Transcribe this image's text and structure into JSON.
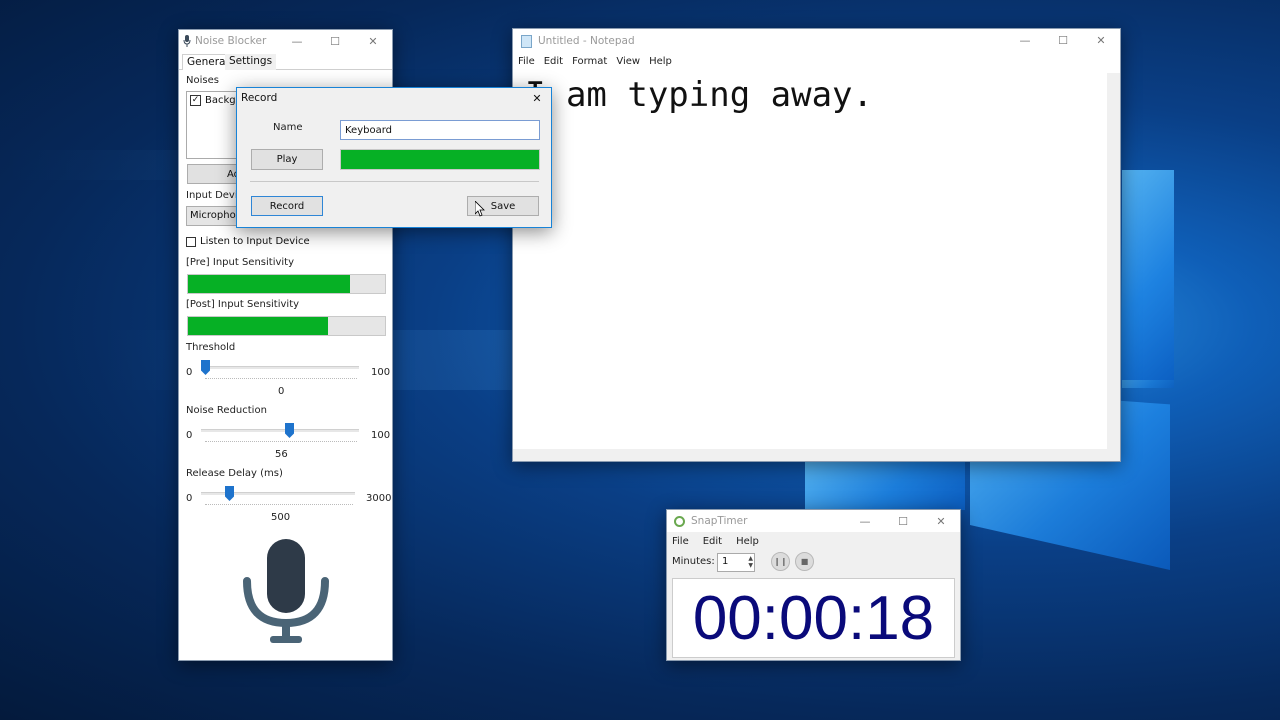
{
  "noise_blocker": {
    "title": "Noise Blocker",
    "tabs": [
      "General",
      "Settings"
    ],
    "noises_label": "Noises",
    "noise_item": "Backgro",
    "add_button": "Ad",
    "input_device_label": "Input Devic",
    "input_device_value": "Micropho",
    "listen_label": "Listen to Input Device",
    "pre_sensitivity_label": "[Pre] Input Sensitivity",
    "pre_sensitivity_level": 0.82,
    "post_sensitivity_label": "[Post] Input Sensitivity",
    "post_sensitivity_level": 0.71,
    "threshold": {
      "label": "Threshold",
      "min": "0",
      "max": "100",
      "value": "0"
    },
    "noise_reduction": {
      "label": "Noise Reduction",
      "min": "0",
      "max": "100",
      "value": "56"
    },
    "release_delay": {
      "label": "Release Delay (ms)",
      "min": "0",
      "max": "3000",
      "value": "500"
    }
  },
  "record_dialog": {
    "title": "Record",
    "name_label": "Name",
    "name_value": "Keyboard",
    "play_button": "Play",
    "level": 1.0,
    "record_button": "Record",
    "save_button": "Save"
  },
  "notepad": {
    "title": "Untitled - Notepad",
    "menu": [
      "File",
      "Edit",
      "Format",
      "View",
      "Help"
    ],
    "content": "I am typing away."
  },
  "snaptimer": {
    "title": "SnapTimer",
    "menu": [
      "File",
      "Edit",
      "Help"
    ],
    "minutes_label": "Minutes:",
    "minutes_value": "1",
    "time": "00:00:18"
  },
  "colors": {
    "meter_green": "#06b025",
    "timer_text": "#0a0a7a",
    "accent": "#1e73cc"
  }
}
